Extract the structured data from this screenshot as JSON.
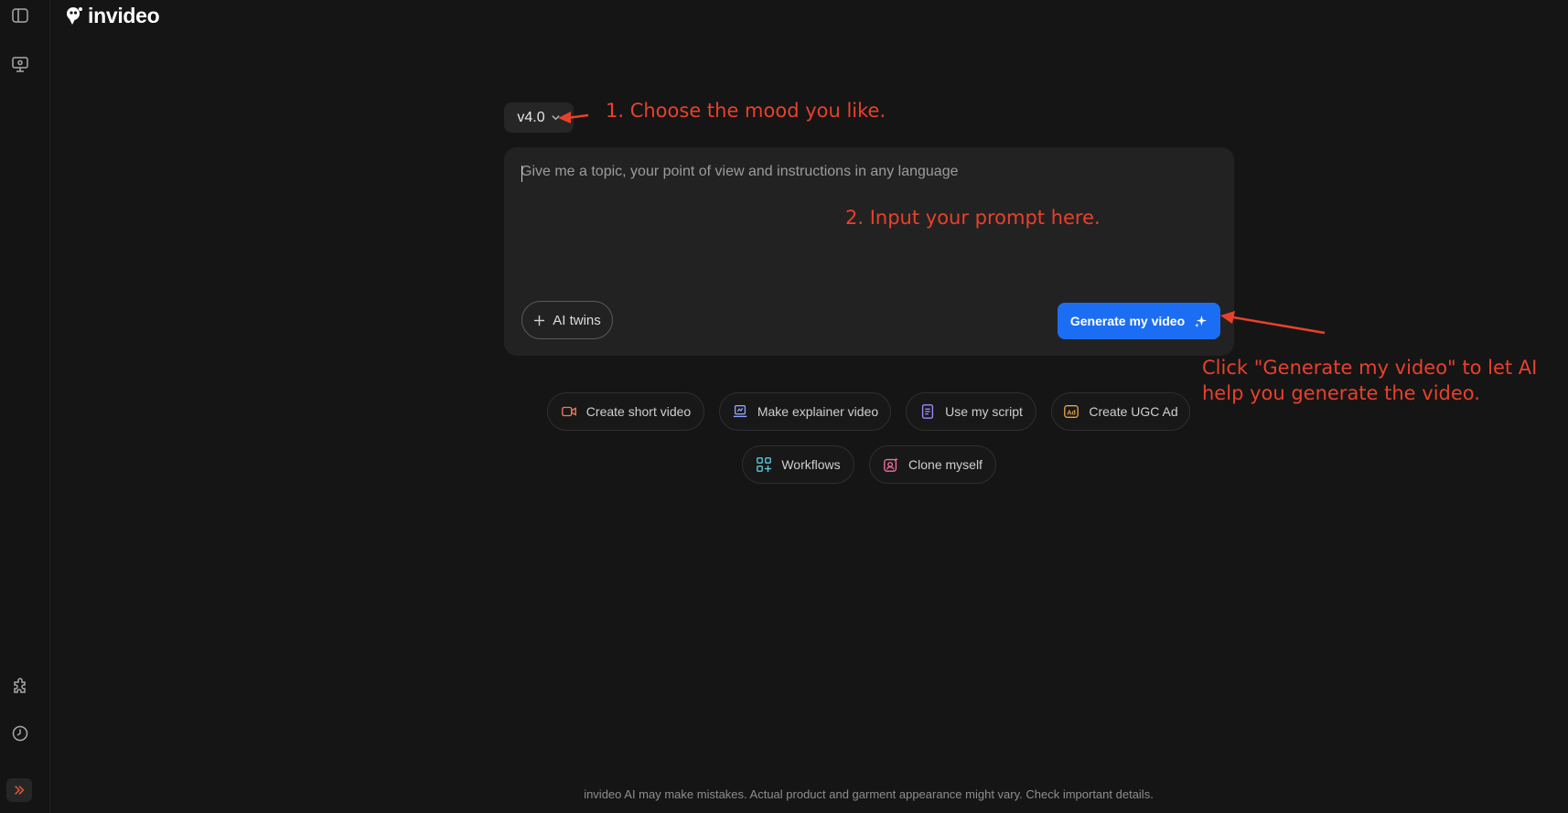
{
  "app": {
    "logo_text": "invideo"
  },
  "sidebar": {
    "top_items": [
      {
        "name": "toggle-sidebar-icon"
      },
      {
        "name": "presentation-icon"
      }
    ],
    "bottom_items": [
      {
        "name": "puzzle-icon"
      },
      {
        "name": "history-icon"
      }
    ],
    "expand": {
      "name": "double-chevron-right-icon"
    }
  },
  "main": {
    "version_selector": {
      "label": "v4.0"
    },
    "prompt": {
      "placeholder": "Give me a topic, your point of view and instructions in any language",
      "value": ""
    },
    "ai_twins_label": "AI twins",
    "generate_label": "Generate my video",
    "chips_row1": [
      {
        "label": "Create short video",
        "icon": "video-camera-icon",
        "color": "#f07a5a"
      },
      {
        "label": "Make explainer video",
        "icon": "laptop-icon",
        "color": "#8fa3ff"
      },
      {
        "label": "Use my script",
        "icon": "document-icon",
        "color": "#9a8cff"
      },
      {
        "label": "Create UGC Ad",
        "icon": "ad-icon",
        "color": "#e9a14b"
      }
    ],
    "chips_row2": [
      {
        "label": "Workflows",
        "icon": "grid-plus-icon",
        "color": "#5cc7d6"
      },
      {
        "label": "Clone myself",
        "icon": "user-sparkle-icon",
        "color": "#f06fa0"
      }
    ]
  },
  "annotations": {
    "step1": "1. Choose the mood you like.",
    "step2": "2. Input your prompt here.",
    "step3_line1": "Click \"Generate my video\" to let AI",
    "step3_line2": "help you generate the video."
  },
  "footer": {
    "disclaimer": "invideo AI may make mistakes. Actual product and garment appearance might vary. Check important details."
  },
  "colors": {
    "background": "#151515",
    "panel": "#222222",
    "primary": "#1b6ef3",
    "annotation": "#e8412b"
  }
}
